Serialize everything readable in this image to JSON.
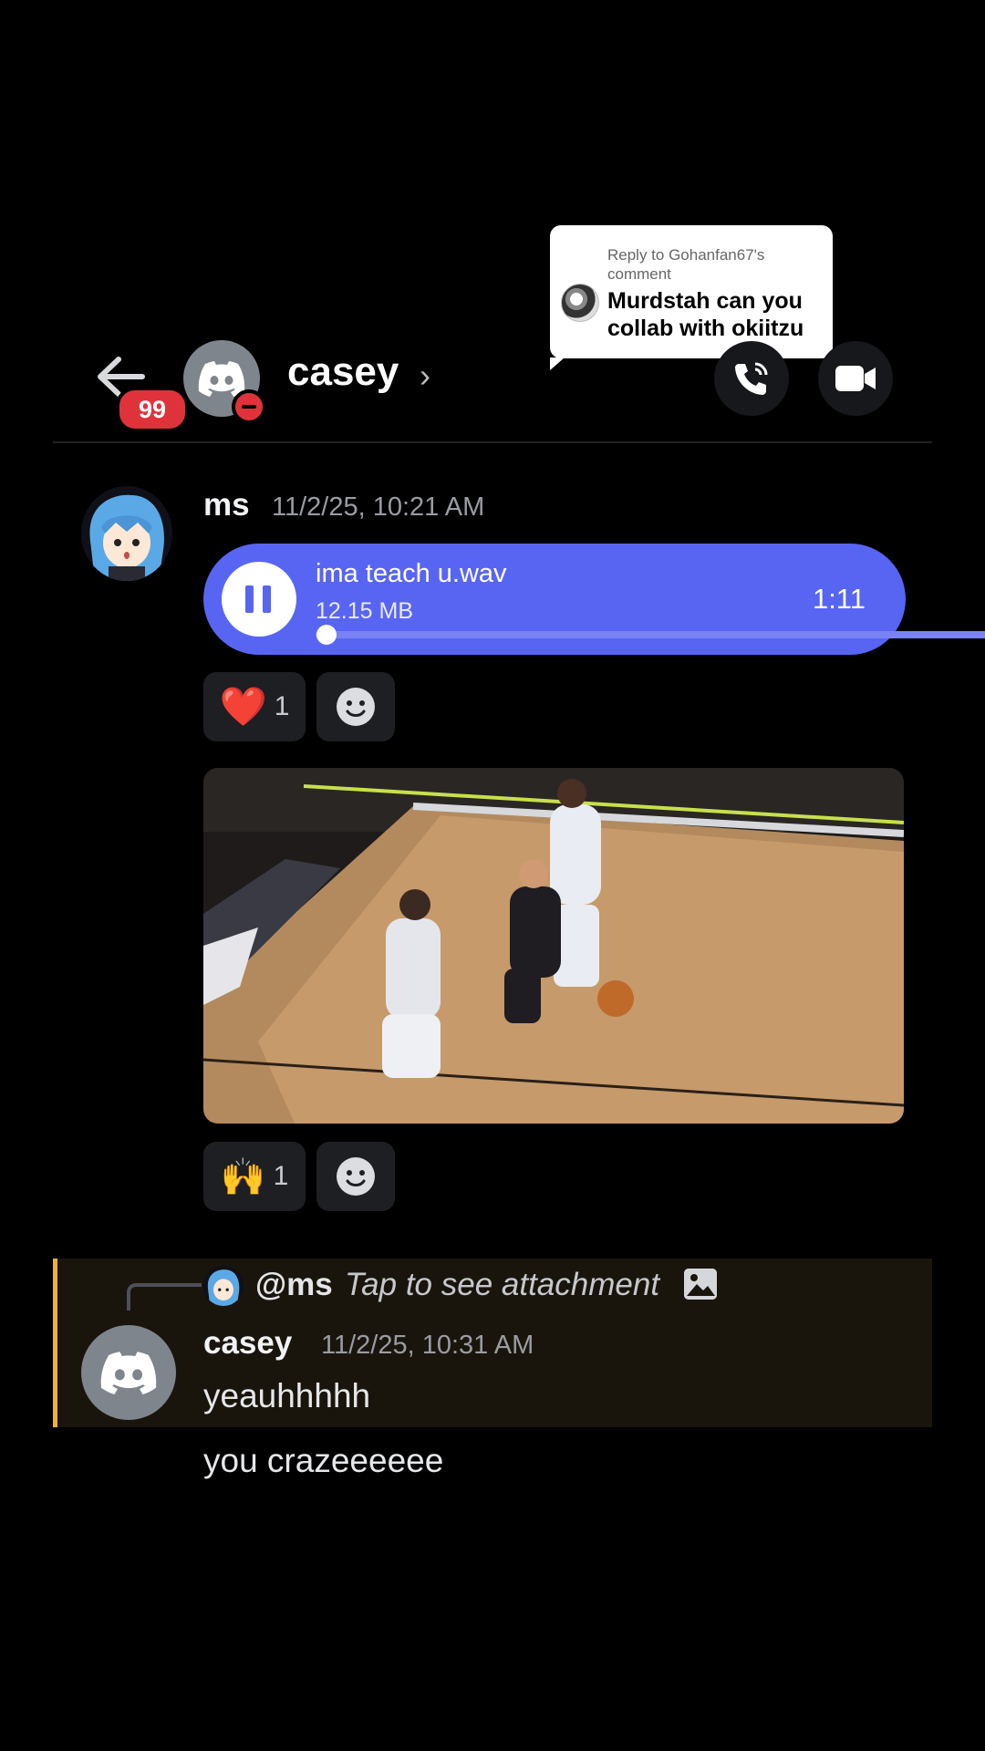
{
  "reply_popup": {
    "meta": "Reply to Gohanfan67's comment",
    "text": "Murdstah can you collab with okiitzu"
  },
  "header": {
    "unread_badge": "99",
    "name": "casey",
    "chevron": "›",
    "status": "do-not-disturb"
  },
  "messages": [
    {
      "author": "ms",
      "timestamp": "11/2/25, 10:21 AM",
      "audio": {
        "filename": "ima teach u.wav",
        "size": "12.15 MB",
        "duration": "1:11",
        "progress": 0.0
      },
      "reaction_audio": {
        "emoji": "❤️",
        "count": "1"
      },
      "reaction_video": {
        "emoji": "🙌",
        "count": "1"
      }
    }
  ],
  "reply_message": {
    "reply_to": "@ms",
    "reply_preview": "Tap to see attachment",
    "author": "casey",
    "timestamp": "11/2/25, 10:31 AM",
    "text": "yeauhhhhh"
  },
  "followup_text": "you crazeeeeee",
  "colors": {
    "accent": "#5865f2",
    "dnd": "#e0323a",
    "mention_bar": "#f0b232",
    "mention_bg": "#1a150c"
  }
}
